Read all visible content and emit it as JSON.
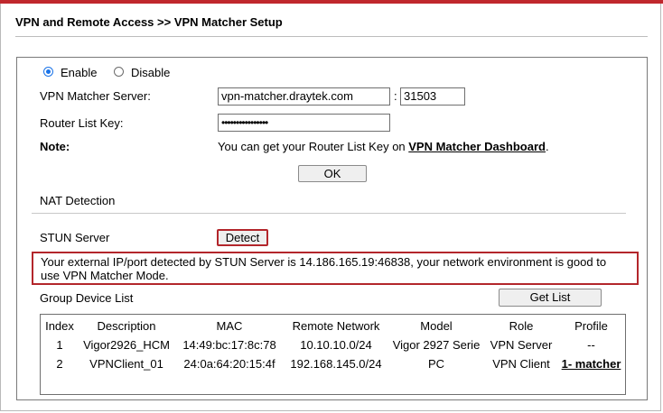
{
  "header": {
    "title": "VPN and Remote Access >> VPN Matcher Setup"
  },
  "mode": {
    "enable_label": "Enable",
    "disable_label": "Disable",
    "selected": "Enable"
  },
  "server": {
    "label": "VPN Matcher Server:",
    "host": "vpn-matcher.draytek.com",
    "separator": ":",
    "port": "31503"
  },
  "router_key": {
    "label": "Router List Key:",
    "value": "••••••••••••••••"
  },
  "note": {
    "label": "Note:",
    "text": "You can get your Router List Key on ",
    "link": "VPN Matcher Dashboard",
    "suffix": "."
  },
  "ok_button": "OK",
  "nat": {
    "heading": "NAT Detection",
    "stun_label": "STUN Server",
    "detect_button": "Detect"
  },
  "alert": {
    "line1": "Your external IP/port detected by STUN Server is 14.186.165.19:46838, your network environment is good to",
    "line2": "use VPN Matcher Mode."
  },
  "group": {
    "label": "Group Device List",
    "get_list_button": "Get List"
  },
  "table": {
    "headers": [
      "Index",
      "Description",
      "MAC",
      "Remote Network",
      "Model",
      "Role",
      "Profile"
    ],
    "rows": [
      [
        "1",
        "Vigor2926_HCM",
        "14:49:bc:17:8c:78",
        "10.10.10.0/24",
        "Vigor 2927 Serie",
        "VPN Server",
        "--"
      ],
      [
        "2",
        "VPNClient_01",
        "24:0a:64:20:15:4f",
        "192.168.145.0/24",
        "PC",
        "VPN Client",
        "1- matcher"
      ]
    ]
  },
  "colors": {
    "accent_red": "#c0282d",
    "radio_blue": "#1a73e8"
  }
}
